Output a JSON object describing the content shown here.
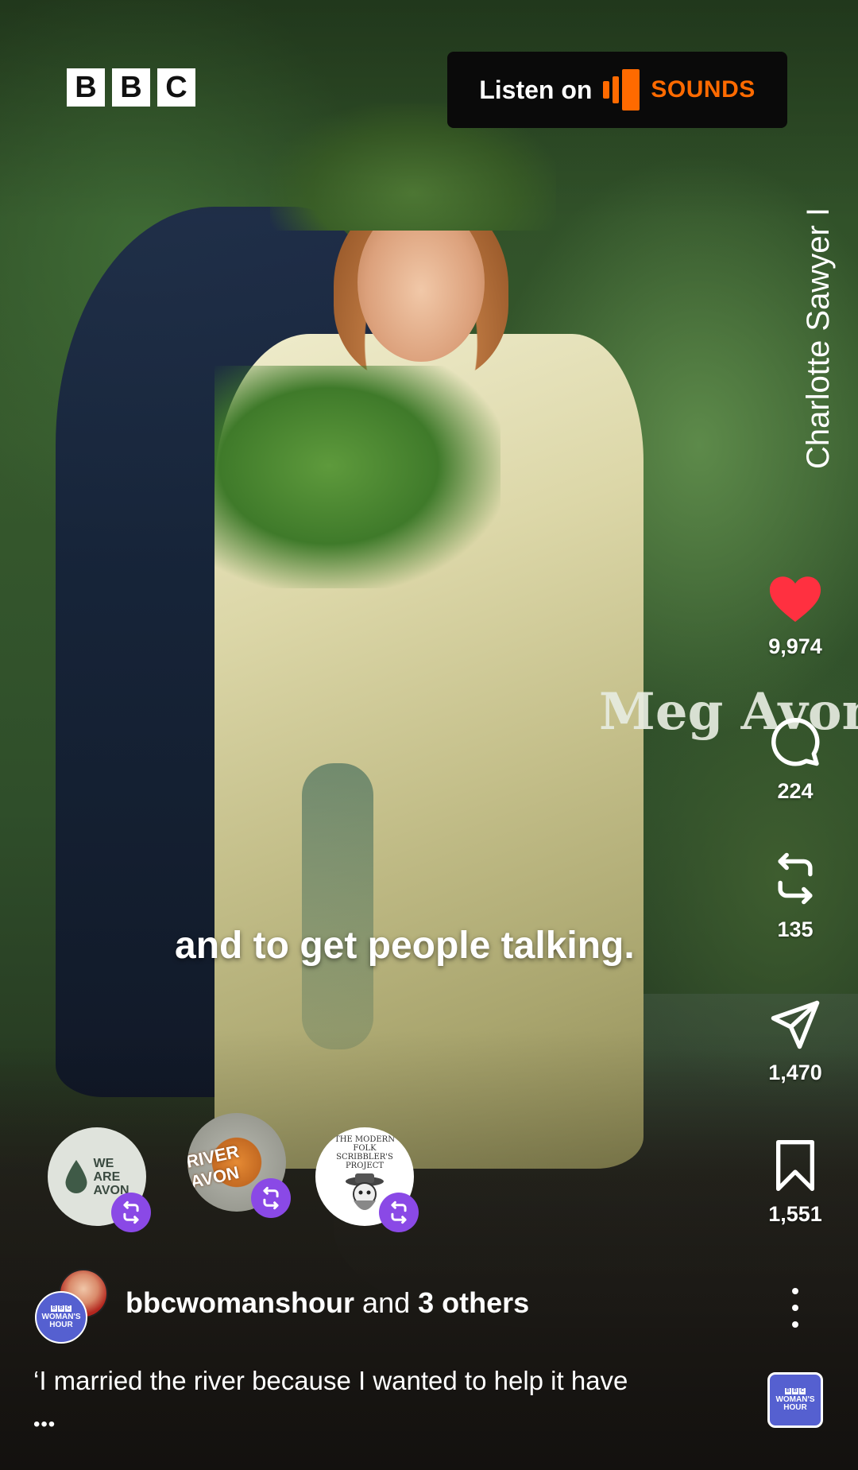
{
  "brand": {
    "letters": [
      "B",
      "B",
      "C"
    ]
  },
  "sounds_badge": {
    "listen_label": "Listen on",
    "brand_word": "SOUNDS",
    "brand_color": "#ff6a00"
  },
  "photo_credit": "Charlotte Sawyer I",
  "name_title": "Meg Avon",
  "subtitle": "and to get people talking.",
  "rail": {
    "like": {
      "count": "9,974",
      "icon": "heart-icon",
      "color": "#ff3040"
    },
    "comment": {
      "count": "224",
      "icon": "comment-icon"
    },
    "repost": {
      "count": "135",
      "icon": "repost-icon"
    },
    "share": {
      "count": "1,470",
      "icon": "paper-plane-icon"
    },
    "save": {
      "count": "1,551",
      "icon": "bookmark-icon"
    }
  },
  "collaborators": [
    {
      "badge_text": [
        "WE",
        "ARE",
        "AVON"
      ],
      "icon": "repost-icon"
    },
    {
      "badge_text": "RIVER AVON",
      "icon": "repost-icon"
    },
    {
      "badge_text": "THE MODERN FOLK SCRIBBLER'S PROJECT",
      "icon": "repost-icon"
    }
  ],
  "author": {
    "avatar_label": [
      "BBC",
      "WOMAN'S",
      "HOUR"
    ],
    "username": "bbcwomanshour",
    "connector": "and",
    "others": "3 others"
  },
  "caption": {
    "text": "‘I married the river because I wanted to help it have",
    "more": "•••"
  },
  "sound_thumb": {
    "label": [
      "BBC",
      "WOMAN'S",
      "HOUR"
    ]
  },
  "colors": {
    "accent_purple": "#8a49e6",
    "womans_hour_blue": "#5560d0"
  }
}
